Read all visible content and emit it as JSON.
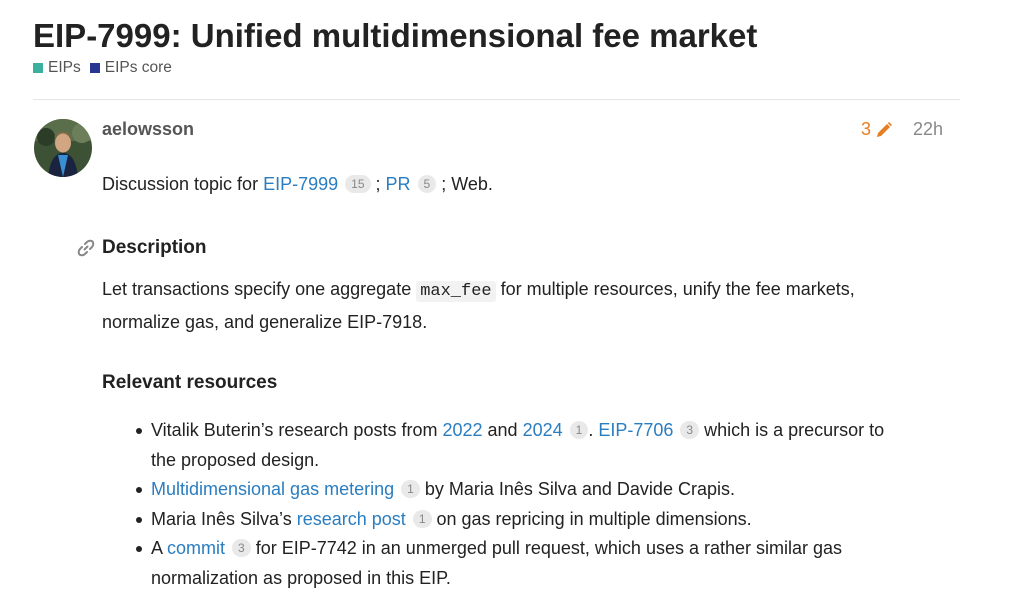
{
  "topic": {
    "title": "EIP-7999: Unified multidimensional fee market",
    "categories": [
      {
        "label": "EIPs",
        "color": "#3ab09e"
      },
      {
        "label": "EIPs core",
        "color": "#283593"
      }
    ]
  },
  "post": {
    "username": "aelowsson",
    "edit_count": "3",
    "age": "22h",
    "discussion": {
      "prefix": "Discussion topic for ",
      "link1": "EIP-7999",
      "link1_count": "15",
      "sep": " ; ",
      "link2": "PR",
      "link2_count": "5",
      "suffix": " ; Web."
    },
    "description_heading": "Description",
    "description": {
      "part1": "Let transactions specify one aggregate ",
      "code": "max_fee",
      "part2": " for multiple resources, unify the fee markets,",
      "line2": "normalize gas, and generalize EIP-7918."
    },
    "resources_heading": "Relevant resources",
    "resources": {
      "item1": {
        "t1": "Vitalik Buterin’s research posts from ",
        "l1": "2022",
        "t2": " and ",
        "l2": "2024",
        "l2_count": "1",
        "t3": ". ",
        "l3": "EIP-7706",
        "l3_count": "3",
        "t4": " which is a precursor to",
        "line2": "the proposed design."
      },
      "item2": {
        "l1": "Multidimensional gas metering",
        "l1_count": "1",
        "t1": " by Maria Inês Silva and Davide Crapis."
      },
      "item3": {
        "t1": "Maria Inês Silva’s ",
        "l1": "research post",
        "l1_count": "1",
        "t2": " on gas repricing in multiple dimensions."
      },
      "item4": {
        "t1": "A ",
        "l1": "commit",
        "l1_count": "3",
        "t2": " for EIP-7742 in an unmerged pull request, which uses a rather similar gas",
        "line2": "normalization as proposed in this EIP."
      }
    }
  }
}
